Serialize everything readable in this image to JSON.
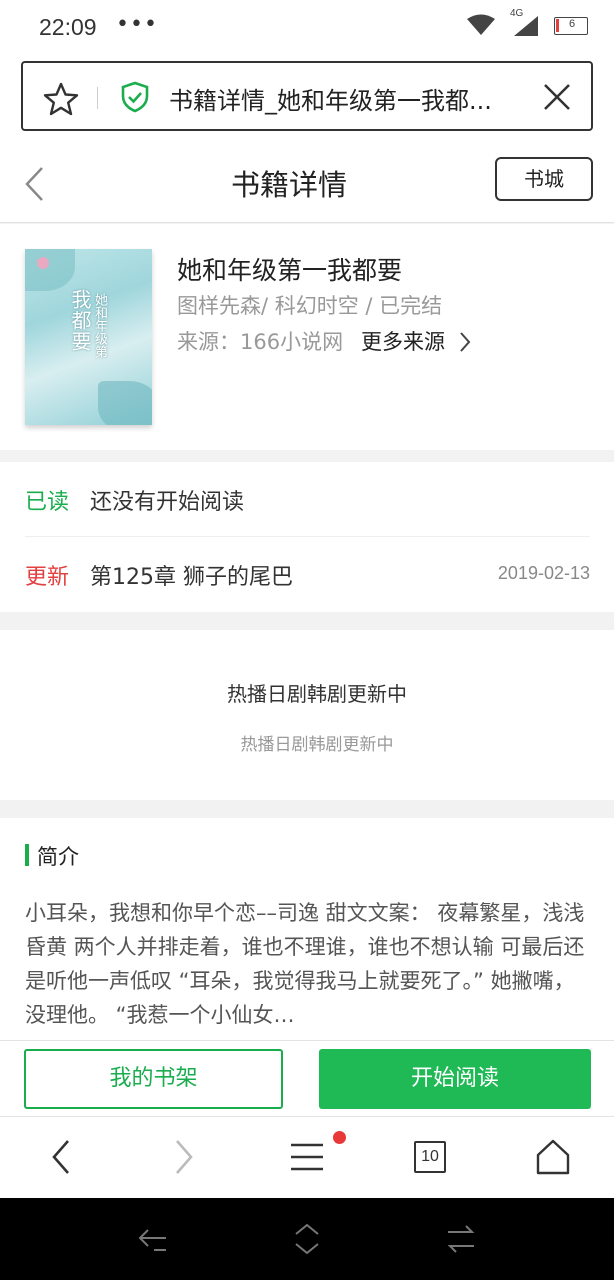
{
  "status": {
    "time": "22:09",
    "dots": "•••",
    "network": "4G",
    "battery": "6"
  },
  "urlbar": {
    "title": "书籍详情_她和年级第一我都..."
  },
  "header": {
    "title": "书籍详情",
    "store_button": "书城"
  },
  "book": {
    "cover_title": "我都要",
    "cover_title2": "她和年级第",
    "name": "她和年级第一我都要",
    "meta": "图样先森/ 科幻时空 / 已完结",
    "source": "来源：166小说网",
    "more_sources": "更多来源"
  },
  "progress": {
    "read_label": "已读",
    "read_text": "还没有开始阅读",
    "update_label": "更新",
    "update_text": "第125章 狮子的尾巴",
    "update_date": "2019-02-13"
  },
  "ad": {
    "title": "热播日剧韩剧更新中",
    "subtitle": "热播日剧韩剧更新中"
  },
  "intro": {
    "heading": "简介",
    "text": "小耳朵，我想和你早个恋––司逸 甜文文案： 夜幕繁星，浅浅昏黄 两个人并排走着，谁也不理谁，谁也不想认输 可最后还是听他一声低叹 “耳朵，我觉得我马上就要死了。” 她撇嘴，没理他。 “我惹一个小仙女…"
  },
  "actions": {
    "shelf": "我的书架",
    "read": "开始阅读"
  },
  "browser_nav": {
    "tab_count": "10"
  },
  "colors": {
    "accent": "#1aad4d",
    "update_red": "#e34040"
  }
}
